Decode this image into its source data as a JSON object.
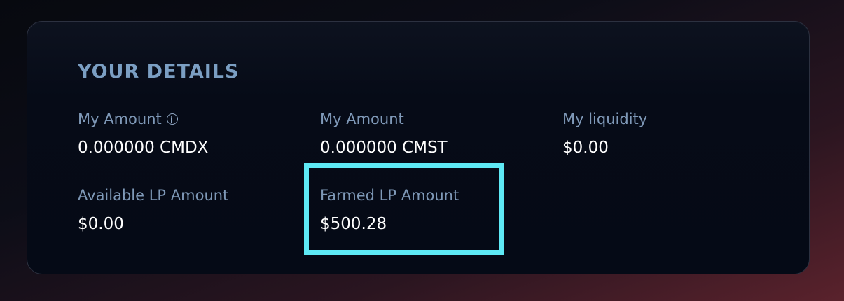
{
  "details": {
    "title": "YOUR DETAILS",
    "info_icon": "info-circle-icon",
    "items": [
      {
        "label": "My Amount",
        "value": "0.000000 CMDX",
        "has_info": true
      },
      {
        "label": "My Amount",
        "value": "0.000000 CMST"
      },
      {
        "label": "My liquidity",
        "value": "$0.00"
      },
      {
        "label": "Available LP Amount",
        "value": "$0.00"
      },
      {
        "label": "Farmed LP Amount",
        "value": "$500.28",
        "highlighted": true
      }
    ]
  },
  "colors": {
    "title": "#7b9fc3",
    "label": "#7f99b8",
    "value": "#ffffff",
    "highlight": "#5ee9f5",
    "card_bg": "#050a16"
  }
}
